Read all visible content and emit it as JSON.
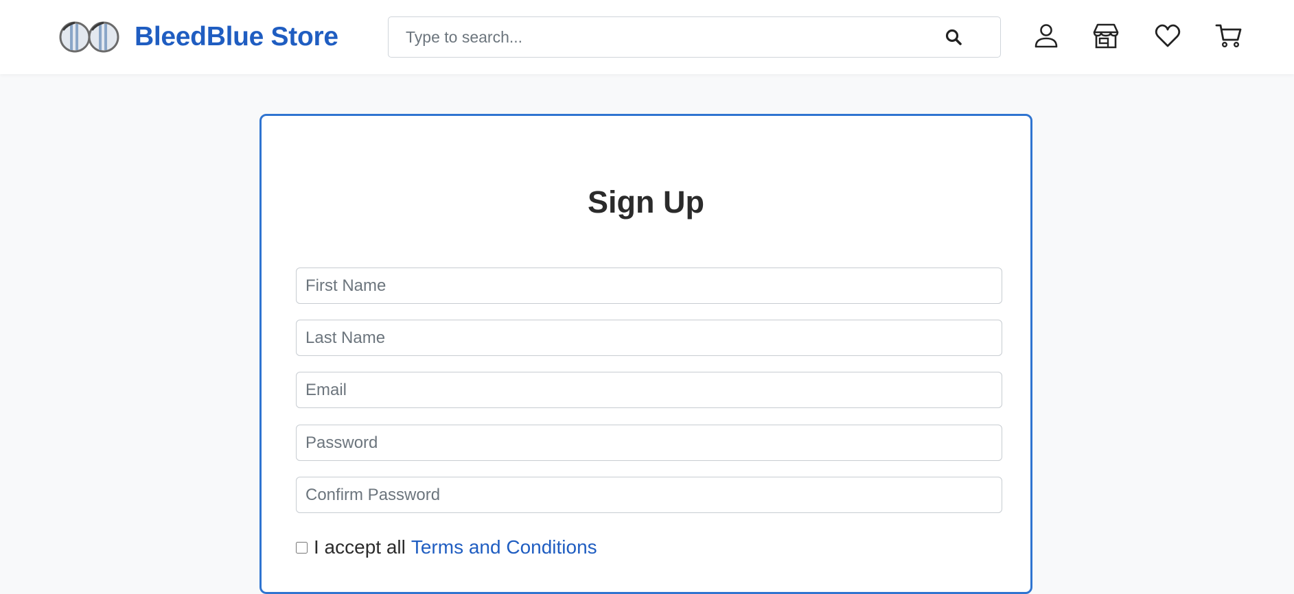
{
  "header": {
    "brand_name": "BleedBlue Store",
    "search_placeholder": "Type to search...",
    "icons": [
      "user-icon",
      "store-icon",
      "heart-icon",
      "cart-icon"
    ],
    "brand_color": "#1f5dc1"
  },
  "form": {
    "title": "Sign Up",
    "fields": {
      "first_name": "First Name",
      "last_name": "Last Name",
      "email": "Email",
      "password": "Password",
      "confirm_password": "Confirm Password"
    },
    "terms_prefix": "I accept all",
    "terms_link": "Terms and Conditions",
    "accent_color": "#2f74d0"
  }
}
